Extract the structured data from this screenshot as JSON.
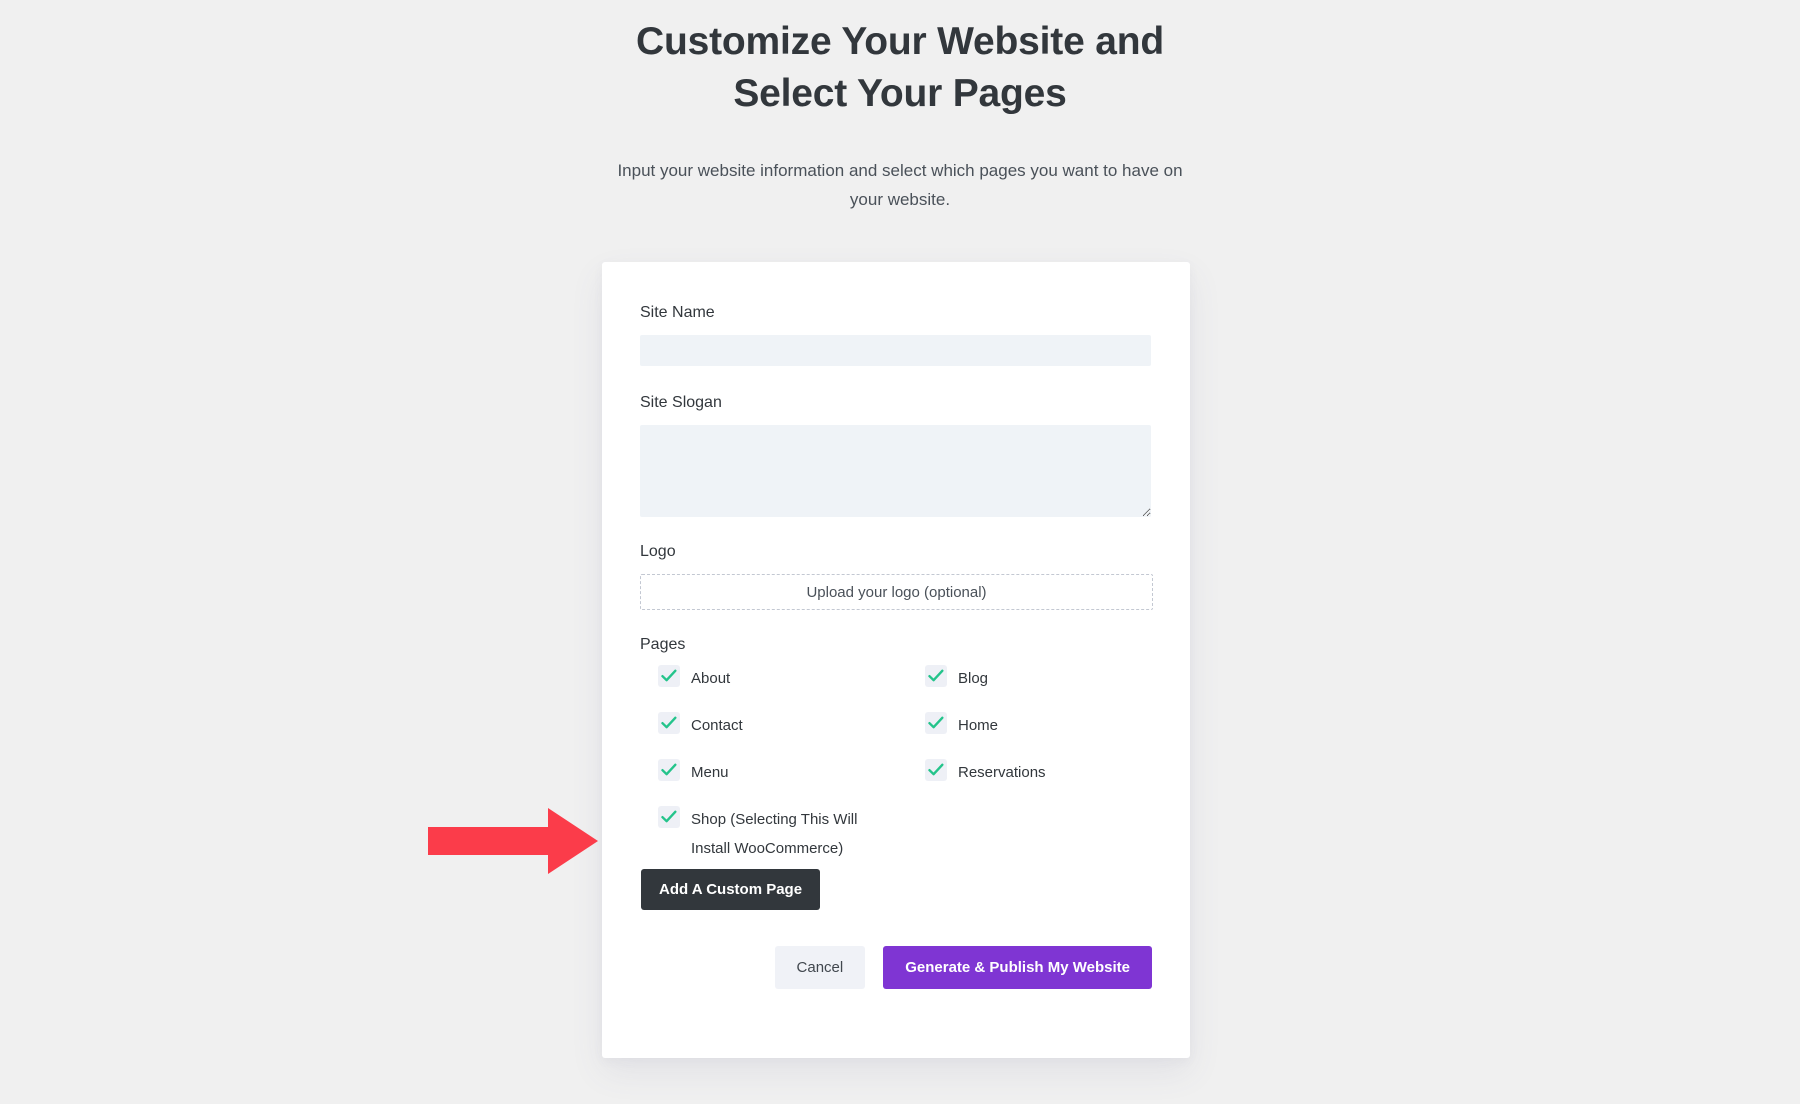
{
  "header": {
    "title": "Customize Your Website and Select Your Pages",
    "subtitle": "Input your website information and select which pages you want to have on your website."
  },
  "form": {
    "site_name": {
      "label": "Site Name",
      "value": "",
      "placeholder": ""
    },
    "site_slogan": {
      "label": "Site Slogan",
      "value": "",
      "placeholder": ""
    },
    "logo": {
      "label": "Logo",
      "upload_text": "Upload your logo (optional)"
    },
    "pages": {
      "label": "Pages",
      "options": [
        {
          "label": "About",
          "checked": true
        },
        {
          "label": "Blog",
          "checked": true
        },
        {
          "label": "Contact",
          "checked": true
        },
        {
          "label": "Home",
          "checked": true
        },
        {
          "label": "Menu",
          "checked": true
        },
        {
          "label": "Reservations",
          "checked": true
        },
        {
          "label": "Shop (Selecting This Will Install WooCommerce)",
          "checked": true
        }
      ]
    },
    "add_custom_page_label": "Add A Custom Page"
  },
  "actions": {
    "cancel_label": "Cancel",
    "generate_label": "Generate & Publish My Website"
  },
  "annotation": {
    "arrow_color": "#fb3c4a",
    "points_at": "Shop (Selecting This Will Install WooCommerce)"
  },
  "colors": {
    "page_background": "#f0f0f0",
    "card_background": "#ffffff",
    "input_background": "#eff3f7",
    "checkbox_background": "#eef0f6",
    "checkmark": "#24c48b",
    "primary_button": "#7f35d3",
    "dark_button": "#32373c",
    "cancel_button": "#f0f2f7",
    "text_primary": "#32373c",
    "text_secondary": "#4a5159"
  }
}
